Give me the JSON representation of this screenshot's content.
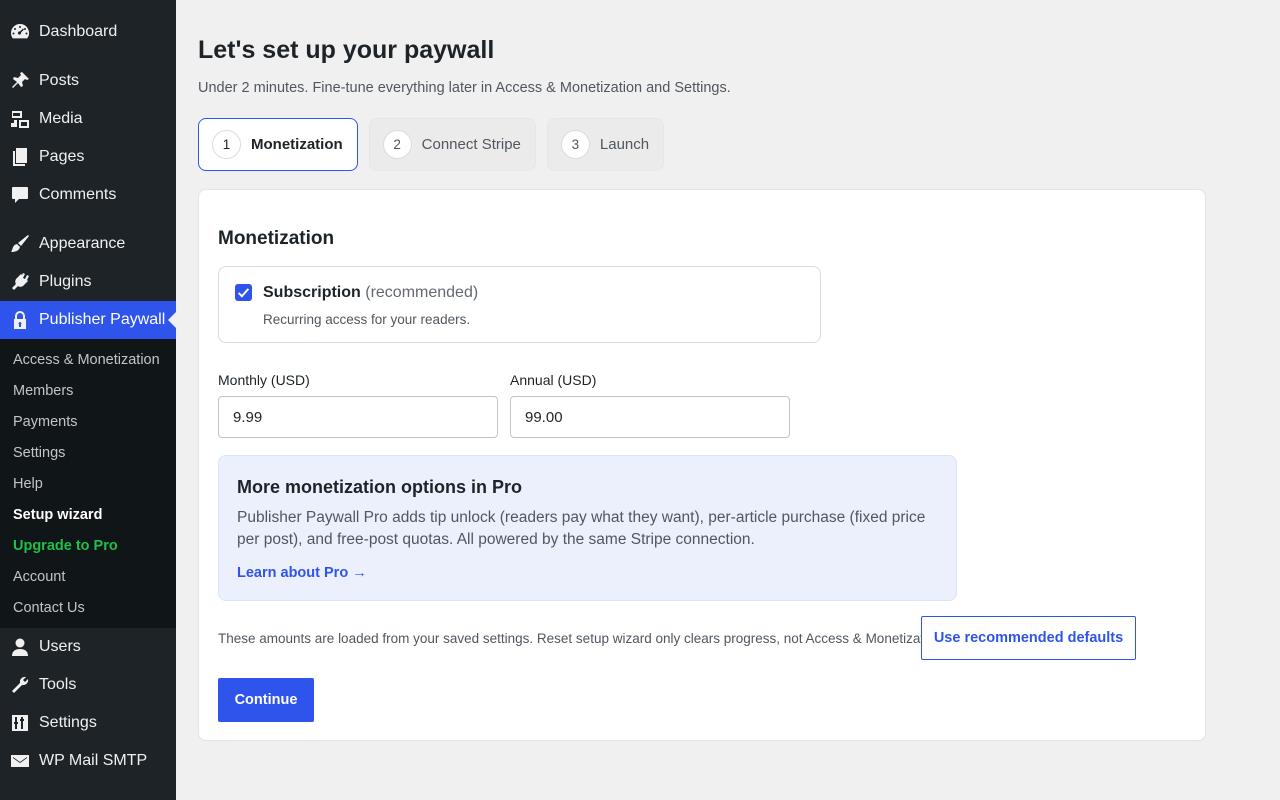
{
  "sidebar": {
    "menu_top": [
      {
        "label": "Dashboard",
        "icon": "dashboard-icon"
      },
      {
        "label": "Posts",
        "icon": "pin-icon"
      },
      {
        "label": "Media",
        "icon": "media-icon"
      },
      {
        "label": "Pages",
        "icon": "pages-icon"
      },
      {
        "label": "Comments",
        "icon": "comment-icon"
      },
      {
        "label": "Appearance",
        "icon": "brush-icon"
      },
      {
        "label": "Plugins",
        "icon": "plug-icon"
      },
      {
        "label": "Publisher Paywall",
        "icon": "lock-icon"
      }
    ],
    "submenu": [
      "Access & Monetization",
      "Members",
      "Payments",
      "Settings",
      "Help",
      "Setup wizard",
      "Upgrade to Pro",
      "Account",
      "Contact Us"
    ],
    "menu_bottom": [
      {
        "label": "Users",
        "icon": "user-icon"
      },
      {
        "label": "Tools",
        "icon": "wrench-icon"
      },
      {
        "label": "Settings",
        "icon": "sliders-icon"
      },
      {
        "label": "WP Mail SMTP",
        "icon": "mail-icon"
      }
    ]
  },
  "page": {
    "title": "Let's set up your paywall",
    "subtitle": "Under 2 minutes. Fine-tune everything later in Access & Monetization and Settings."
  },
  "steps": [
    {
      "num": "1",
      "label": "Monetization",
      "active": true
    },
    {
      "num": "2",
      "label": "Connect Stripe",
      "active": false
    },
    {
      "num": "3",
      "label": "Launch",
      "active": false
    }
  ],
  "card": {
    "section_title": "Monetization",
    "option": {
      "label": "Subscription",
      "tag": "(recommended)",
      "description": "Recurring access for your readers.",
      "checked": true
    },
    "fields": {
      "monthly_label": "Monthly (USD)",
      "monthly_value": "9.99",
      "annual_label": "Annual (USD)",
      "annual_value": "99.00"
    },
    "pro": {
      "title": "More monetization options in Pro",
      "text": "Publisher Paywall Pro adds tip unlock (readers pay what they want), per-article purchase (fixed price per post), and free-post quotas. All powered by the same Stripe connection.",
      "link": "Learn about Pro →"
    },
    "note": "These amounts are loaded from your saved settings. Reset setup wizard only clears progress, not Access & Monetization.",
    "defaults_button": "Use recommended defaults",
    "continue_button": "Continue"
  },
  "colors": {
    "accent": "#2f54eb",
    "sidebar_bg": "#1d2327",
    "upgrade": "#1fbf4a"
  }
}
